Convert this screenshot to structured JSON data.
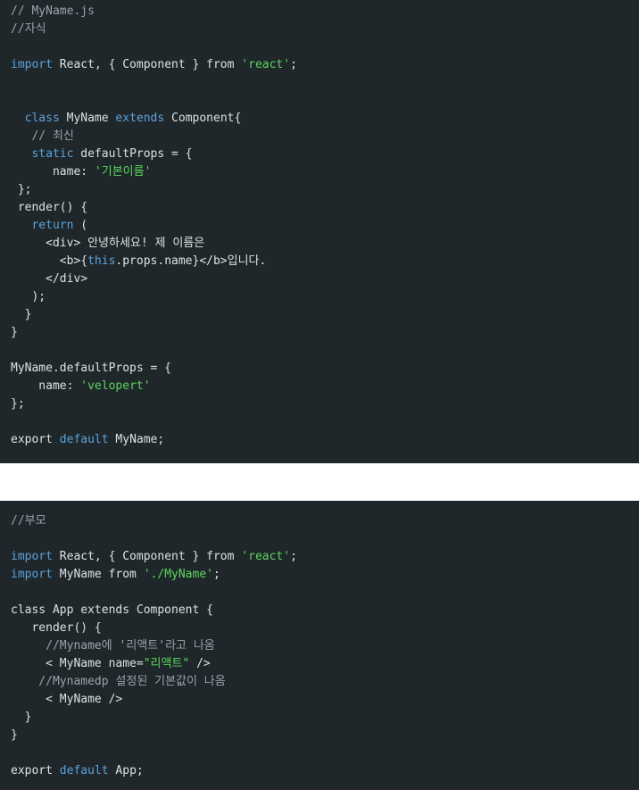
{
  "colors": {
    "code_background": "#1f272b",
    "page_background": "#ffffff",
    "plain_text": "#dde1e3",
    "keyword": "#5ba3d9",
    "string": "#5cd65c",
    "comment": "#9aa3a8"
  },
  "blocks": [
    {
      "name": "child-code-block",
      "lines": [
        [
          {
            "t": "// MyName.js",
            "c": "comment"
          }
        ],
        [
          {
            "t": "//자식",
            "c": "comment"
          }
        ],
        [],
        [
          {
            "t": "import",
            "c": "keyword"
          },
          {
            "t": " React, { Component } from ",
            "c": "plain"
          },
          {
            "t": "'react'",
            "c": "string"
          },
          {
            "t": ";",
            "c": "plain"
          }
        ],
        [],
        [],
        [
          {
            "t": "  ",
            "c": "plain"
          },
          {
            "t": "class",
            "c": "keyword"
          },
          {
            "t": " MyName ",
            "c": "plain"
          },
          {
            "t": "extends",
            "c": "keyword"
          },
          {
            "t": " Component{",
            "c": "plain"
          }
        ],
        [
          {
            "t": "   // 최신",
            "c": "comment"
          }
        ],
        [
          {
            "t": "   ",
            "c": "plain"
          },
          {
            "t": "static",
            "c": "keyword"
          },
          {
            "t": " defaultProps = {",
            "c": "plain"
          }
        ],
        [
          {
            "t": "      name: ",
            "c": "plain"
          },
          {
            "t": "'기본이름'",
            "c": "string"
          }
        ],
        [
          {
            "t": " };",
            "c": "plain"
          }
        ],
        [
          {
            "t": " render() {",
            "c": "plain"
          }
        ],
        [
          {
            "t": "   ",
            "c": "plain"
          },
          {
            "t": "return",
            "c": "keyword"
          },
          {
            "t": " (",
            "c": "plain"
          }
        ],
        [
          {
            "t": "     <div> 안녕하세요! 제 이름은",
            "c": "plain"
          }
        ],
        [
          {
            "t": "       <b>{",
            "c": "plain"
          },
          {
            "t": "this",
            "c": "keyword"
          },
          {
            "t": ".props.name}</b>입니다.",
            "c": "plain"
          }
        ],
        [
          {
            "t": "     </div>",
            "c": "plain"
          }
        ],
        [
          {
            "t": "   );",
            "c": "plain"
          }
        ],
        [
          {
            "t": "  }",
            "c": "plain"
          }
        ],
        [
          {
            "t": "}",
            "c": "plain"
          }
        ],
        [],
        [
          {
            "t": "MyName.defaultProps = {",
            "c": "plain"
          }
        ],
        [
          {
            "t": "    name: ",
            "c": "plain"
          },
          {
            "t": "'velopert'",
            "c": "string"
          }
        ],
        [
          {
            "t": "};",
            "c": "plain"
          }
        ],
        [],
        [
          {
            "t": "export",
            "c": "plain"
          },
          {
            "t": " ",
            "c": "plain"
          },
          {
            "t": "default",
            "c": "keyword"
          },
          {
            "t": " MyName;",
            "c": "plain"
          }
        ]
      ]
    },
    {
      "name": "parent-code-block",
      "lines": [
        [
          {
            "t": "//부모",
            "c": "comment"
          }
        ],
        [],
        [
          {
            "t": "import",
            "c": "keyword"
          },
          {
            "t": " React, { Component } from ",
            "c": "plain"
          },
          {
            "t": "'react'",
            "c": "string"
          },
          {
            "t": ";",
            "c": "plain"
          }
        ],
        [
          {
            "t": "import",
            "c": "keyword"
          },
          {
            "t": " MyName from ",
            "c": "plain"
          },
          {
            "t": "'./MyName'",
            "c": "string"
          },
          {
            "t": ";",
            "c": "plain"
          }
        ],
        [],
        [
          {
            "t": "class App extends Component {",
            "c": "plain"
          }
        ],
        [
          {
            "t": "   render() {",
            "c": "plain"
          }
        ],
        [
          {
            "t": "     //Myname에 '리액트'라고 나옴",
            "c": "comment"
          }
        ],
        [
          {
            "t": "     < MyName name=",
            "c": "plain"
          },
          {
            "t": "\"리액트\"",
            "c": "string"
          },
          {
            "t": " />",
            "c": "plain"
          }
        ],
        [
          {
            "t": "    //Mynamedp 설정된 기본값이 나옴",
            "c": "comment"
          }
        ],
        [
          {
            "t": "     < MyName />",
            "c": "plain"
          }
        ],
        [
          {
            "t": "  }",
            "c": "plain"
          }
        ],
        [
          {
            "t": "}",
            "c": "plain"
          }
        ],
        [],
        [
          {
            "t": "export",
            "c": "plain"
          },
          {
            "t": " ",
            "c": "plain"
          },
          {
            "t": "default",
            "c": "keyword"
          },
          {
            "t": " App;",
            "c": "plain"
          }
        ]
      ]
    }
  ]
}
